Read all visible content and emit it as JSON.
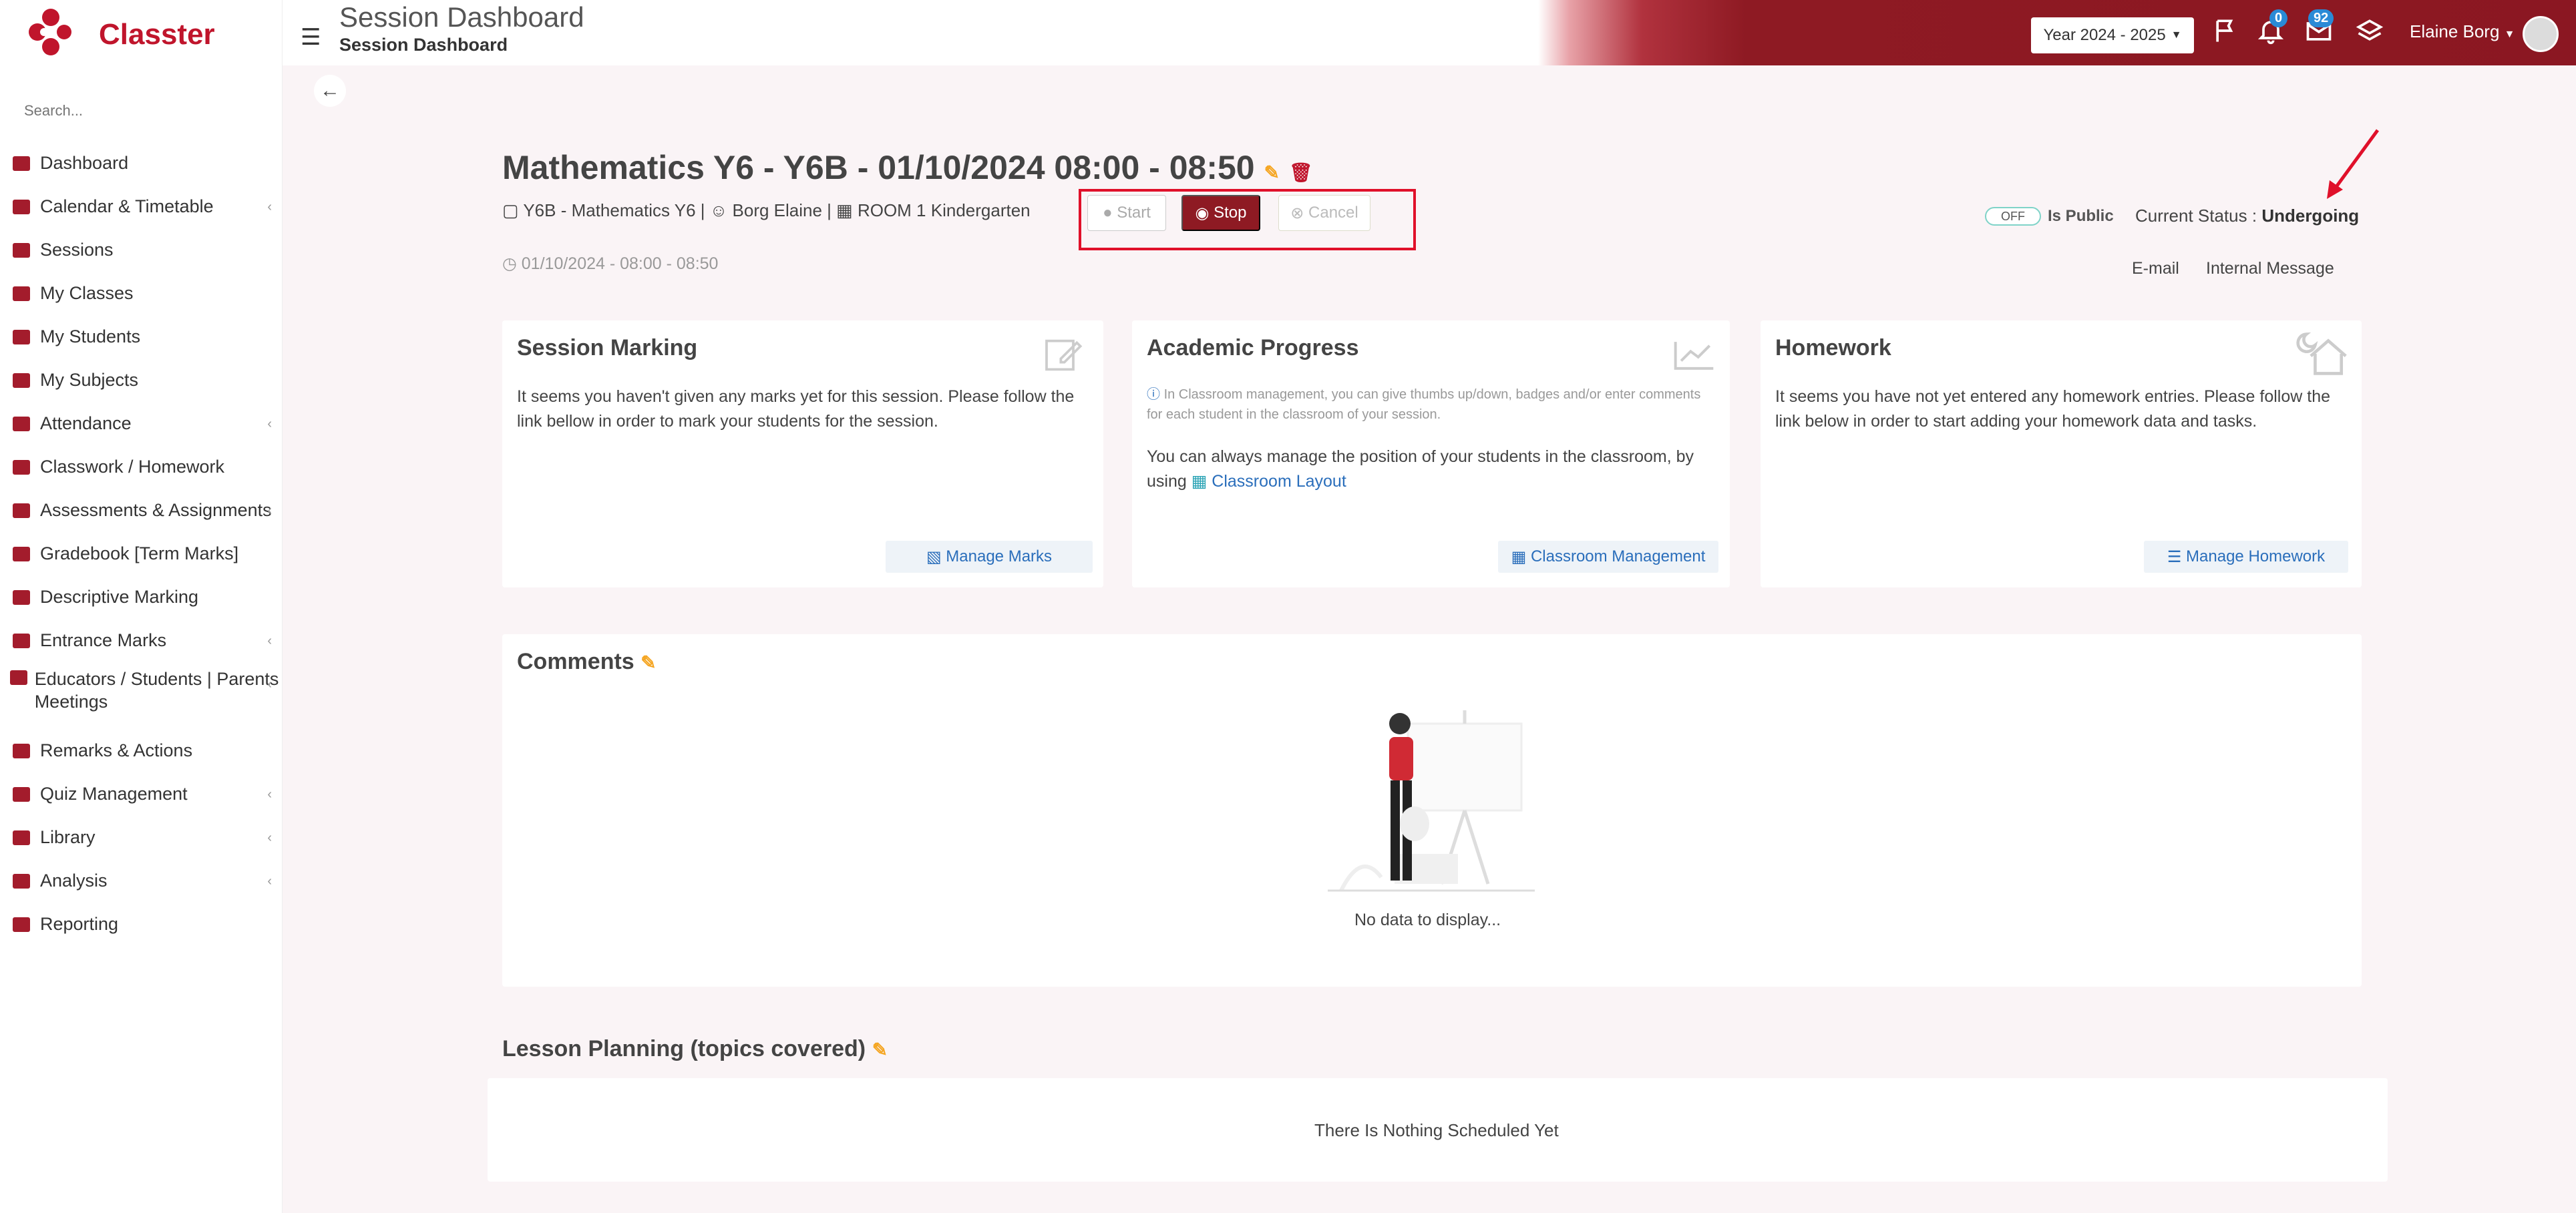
{
  "brand": {
    "name": "Classter",
    "accent": "#c0152c",
    "dark_red": "#8e1a23",
    "link_blue": "#2a6ebb"
  },
  "sidebar": {
    "search_placeholder": "Search...",
    "items": [
      {
        "label": "Dashboard",
        "icon": "monitor-icon",
        "chevron": ""
      },
      {
        "label": "Calendar & Timetable",
        "icon": "calendar-icon",
        "chevron": "‹"
      },
      {
        "label": "Sessions",
        "icon": "presentation-icon",
        "chevron": ""
      },
      {
        "label": "My Classes",
        "icon": "classroom-icon",
        "chevron": ""
      },
      {
        "label": "My Students",
        "icon": "users-icon",
        "chevron": ""
      },
      {
        "label": "My Subjects",
        "icon": "book-icon",
        "chevron": ""
      },
      {
        "label": "Attendance",
        "icon": "user-check-icon",
        "chevron": "‹"
      },
      {
        "label": "Classwork / Homework",
        "icon": "list-icon",
        "chevron": ""
      },
      {
        "label": "Assessments & Assignments",
        "icon": "edit-icon",
        "chevron": "‹"
      },
      {
        "label": "Gradebook [Term Marks]",
        "icon": "gradebook-icon",
        "chevron": ""
      },
      {
        "label": "Descriptive Marking",
        "icon": "pen-box-icon",
        "chevron": ""
      },
      {
        "label": "Entrance Marks",
        "icon": "clipboard-icon",
        "chevron": "‹"
      },
      {
        "label": "Educators / Students | Parents Meetings",
        "icon": "meeting-icon",
        "chevron": "‹"
      },
      {
        "label": "Remarks & Actions",
        "icon": "shuffle-icon",
        "chevron": ""
      },
      {
        "label": "Quiz Management",
        "icon": "quiz-icon",
        "chevron": "‹"
      },
      {
        "label": "Library",
        "icon": "library-icon",
        "chevron": "‹"
      },
      {
        "label": "Analysis",
        "icon": "bar-chart-icon",
        "chevron": "‹"
      },
      {
        "label": "Reporting",
        "icon": "printer-icon",
        "chevron": ""
      }
    ]
  },
  "header": {
    "title": "Session Dashboard",
    "subtitle": "Session Dashboard",
    "year_select": "Year 2024 - 2025",
    "notifications_count": "0",
    "messages_count": "92",
    "user_name": "Elaine Borg"
  },
  "session": {
    "title": "Mathematics Y6 - Y6B - 01/10/2024 08:00 - 08:50",
    "class_subject": "Y6B - Mathematics Y6",
    "teacher": "Borg Elaine",
    "room": "ROOM 1 Kindergarten",
    "time": "01/10/2024 - 08:00 - 08:50",
    "buttons": {
      "start": "Start",
      "stop": "Stop",
      "cancel": "Cancel"
    },
    "public_toggle": "OFF",
    "is_public_label": "Is Public",
    "status_label": "Current Status :",
    "status_value": "Undergoing",
    "email_link": "E-mail",
    "internal_message_link": "Internal Message"
  },
  "cards": {
    "session_marking": {
      "title": "Session Marking",
      "text": "It seems you haven't given any marks yet for this session. Please follow the link bellow in order to mark your students for the session.",
      "button": "Manage Marks"
    },
    "academic_progress": {
      "title": "Academic Progress",
      "note": "In Classroom management, you can give thumbs up/down, badges and/or enter comments for each student in the classroom of your session.",
      "text": "You can always manage the position of your students in the classroom, by using",
      "link": "Classroom Layout",
      "button": "Classroom Management"
    },
    "homework": {
      "title": "Homework",
      "text": "It seems you have not yet entered any homework entries. Please follow the link below in order to start adding your homework data and tasks.",
      "button": "Manage Homework"
    }
  },
  "comments": {
    "title": "Comments",
    "empty": "No data to display..."
  },
  "lesson_planning": {
    "title": "Lesson Planning (topics covered)",
    "empty": "There Is Nothing Scheduled Yet"
  }
}
